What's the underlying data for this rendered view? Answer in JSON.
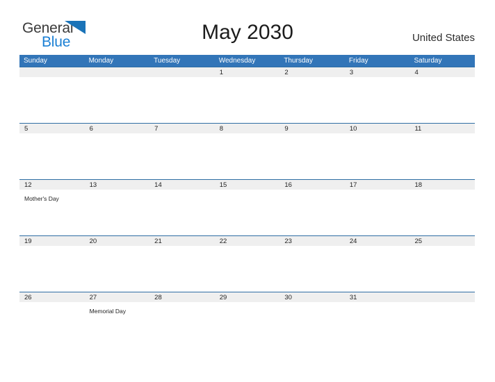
{
  "brand": {
    "name_part1": "General",
    "name_part2": "Blue",
    "flag_icon": "blue-triangle-pennant",
    "accent_color": "#1a7fd4"
  },
  "header": {
    "title": "May 2030",
    "region": "United States"
  },
  "theme": {
    "header_blue": "#3275b8",
    "separator_blue": "#2e6da4",
    "date_band_gray": "#efefef",
    "text_dark": "#1f1f1f"
  },
  "calendar": {
    "month": "May",
    "year": "2030",
    "weekdays": [
      "Sunday",
      "Monday",
      "Tuesday",
      "Wednesday",
      "Thursday",
      "Friday",
      "Saturday"
    ],
    "weeks": [
      {
        "days": [
          {
            "num": "",
            "event": ""
          },
          {
            "num": "",
            "event": ""
          },
          {
            "num": "",
            "event": ""
          },
          {
            "num": "1",
            "event": ""
          },
          {
            "num": "2",
            "event": ""
          },
          {
            "num": "3",
            "event": ""
          },
          {
            "num": "4",
            "event": ""
          }
        ]
      },
      {
        "days": [
          {
            "num": "5",
            "event": ""
          },
          {
            "num": "6",
            "event": ""
          },
          {
            "num": "7",
            "event": ""
          },
          {
            "num": "8",
            "event": ""
          },
          {
            "num": "9",
            "event": ""
          },
          {
            "num": "10",
            "event": ""
          },
          {
            "num": "11",
            "event": ""
          }
        ]
      },
      {
        "days": [
          {
            "num": "12",
            "event": "Mother's Day"
          },
          {
            "num": "13",
            "event": ""
          },
          {
            "num": "14",
            "event": ""
          },
          {
            "num": "15",
            "event": ""
          },
          {
            "num": "16",
            "event": ""
          },
          {
            "num": "17",
            "event": ""
          },
          {
            "num": "18",
            "event": ""
          }
        ]
      },
      {
        "days": [
          {
            "num": "19",
            "event": ""
          },
          {
            "num": "20",
            "event": ""
          },
          {
            "num": "21",
            "event": ""
          },
          {
            "num": "22",
            "event": ""
          },
          {
            "num": "23",
            "event": ""
          },
          {
            "num": "24",
            "event": ""
          },
          {
            "num": "25",
            "event": ""
          }
        ]
      },
      {
        "days": [
          {
            "num": "26",
            "event": ""
          },
          {
            "num": "27",
            "event": "Memorial Day"
          },
          {
            "num": "28",
            "event": ""
          },
          {
            "num": "29",
            "event": ""
          },
          {
            "num": "30",
            "event": ""
          },
          {
            "num": "31",
            "event": ""
          },
          {
            "num": "",
            "event": ""
          }
        ]
      }
    ]
  }
}
